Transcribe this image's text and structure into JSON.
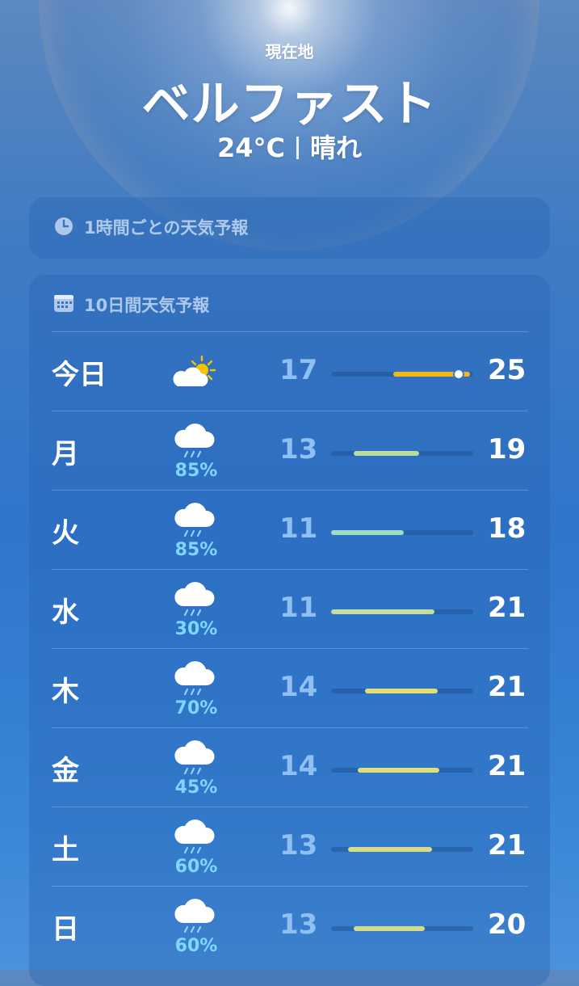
{
  "header": {
    "location_label": "現在地",
    "city": "ベルファスト",
    "temperature": "24°C",
    "condition": "晴れ"
  },
  "hourly_card": {
    "title": "1時間ごとの天気予報",
    "icon": "clock-icon"
  },
  "ten_day_card": {
    "title": "10日間天気予報",
    "icon": "calendar-icon",
    "days": [
      {
        "day": "今日",
        "icon": "partly-sunny-icon",
        "precip": "",
        "low": "17",
        "high": "25",
        "bar_start": 0.44,
        "bar_end": 0.98,
        "bar_color": "#f2b81c",
        "current_marker": 0.9
      },
      {
        "day": "月",
        "icon": "rain-cloud-icon",
        "precip": "85%",
        "low": "13",
        "high": "19",
        "bar_start": 0.16,
        "bar_end": 0.62,
        "bar_color": "#b9dca0"
      },
      {
        "day": "火",
        "icon": "rain-cloud-icon",
        "precip": "85%",
        "low": "11",
        "high": "18",
        "bar_start": 0.0,
        "bar_end": 0.51,
        "bar_color": "#9fdcc4"
      },
      {
        "day": "水",
        "icon": "rain-cloud-icon",
        "precip": "30%",
        "low": "11",
        "high": "21",
        "bar_start": 0.0,
        "bar_end": 0.73,
        "bar_color": "#bfe0a0"
      },
      {
        "day": "木",
        "icon": "rain-cloud-icon",
        "precip": "70%",
        "low": "14",
        "high": "21",
        "bar_start": 0.24,
        "bar_end": 0.75,
        "bar_color": "#e3df78"
      },
      {
        "day": "金",
        "icon": "rain-cloud-icon",
        "precip": "45%",
        "low": "14",
        "high": "21",
        "bar_start": 0.19,
        "bar_end": 0.76,
        "bar_color": "#e0de7a"
      },
      {
        "day": "土",
        "icon": "rain-cloud-icon",
        "precip": "60%",
        "low": "13",
        "high": "21",
        "bar_start": 0.12,
        "bar_end": 0.71,
        "bar_color": "#d8dc86"
      },
      {
        "day": "日",
        "icon": "rain-cloud-icon",
        "precip": "60%",
        "low": "13",
        "high": "20",
        "bar_start": 0.16,
        "bar_end": 0.66,
        "bar_color": "#cfdc8e"
      }
    ]
  }
}
